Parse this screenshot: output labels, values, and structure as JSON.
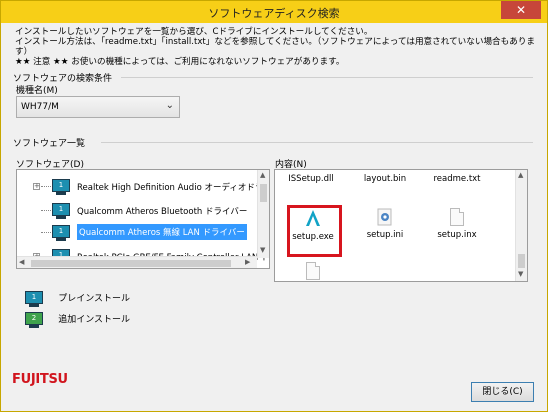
{
  "window": {
    "title": "ソフトウェアディスク検索",
    "close_glyph": "✕"
  },
  "intro": {
    "line1": "インストールしたいソフトウェアを一覧から選び、Cドライブにインストールしてください。",
    "line2": "インストール方法は、「readme.txt」「install.txt」などを参照してください。（ソフトウェアによっては用意されていない場合もあります）",
    "line3": "★★ 注意 ★★ お使いの機種によっては、ご利用になれないソフトウェアがあります。"
  },
  "search": {
    "group_label": "ソフトウェアの検索条件",
    "model_label": "機種名(M)",
    "model_value": "WH77/M",
    "dropdown_icon": "chevron-down-icon"
  },
  "software_list": {
    "group_label": "ソフトウェア一覧",
    "tree_label": "ソフトウェア(D)",
    "items": [
      {
        "label": "Realtek High Definition Audio オーディオドライバー",
        "badge": "1",
        "expand": "+"
      },
      {
        "label": "Qualcomm Atheros Bluetooth ドライバー",
        "badge": "1",
        "expand": ""
      },
      {
        "label": "Qualcomm Atheros 無線 LAN ドライバー",
        "badge": "1",
        "expand": "+"
      },
      {
        "label": "Realtek PCIe GBE/FE Family Controller LAN ドライバー",
        "badge": "1",
        "expand": "+"
      }
    ]
  },
  "contents": {
    "label": "内容(N)",
    "files": [
      {
        "name": "ISSetup.dll",
        "icon": "dll-file-icon"
      },
      {
        "name": "layout.bin",
        "icon": "file-icon"
      },
      {
        "name": "readme.txt",
        "icon": "text-file-icon"
      },
      {
        "name": "setup.exe",
        "icon": "setup-installer-icon"
      },
      {
        "name": "setup.ini",
        "icon": "ini-settings-icon"
      },
      {
        "name": "setup.inx",
        "icon": "file-icon"
      },
      {
        "name": "",
        "icon": "file-icon"
      }
    ]
  },
  "legend": {
    "preinstall": {
      "badge": "1",
      "label": "プレインストール"
    },
    "additional": {
      "badge": "2",
      "label": "追加インストール"
    }
  },
  "footer": {
    "brand": "FUJITSU",
    "close_button": "閉じる(C)"
  },
  "colors": {
    "titlebar": "#f7cf17",
    "selection": "#3399ff",
    "highlight": "#d7151e",
    "brand_red": "#d1151e"
  }
}
